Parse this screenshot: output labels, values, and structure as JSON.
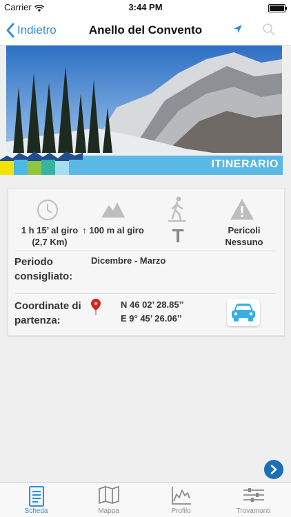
{
  "status_bar": {
    "carrier": "Carrier",
    "time": "3:44 PM"
  },
  "nav": {
    "back_label": "Indietro",
    "title": "Anello del Convento"
  },
  "banner": {
    "label": "ITINERARIO"
  },
  "stats": {
    "duration": "1 h 15’ al giro (2,7 Km)",
    "elevation": "↑ 100 m al giro",
    "difficulty": "T",
    "danger": "Pericoli Nessuno"
  },
  "period": {
    "label": "Periodo consigliato:",
    "value": "Dicembre - Marzo"
  },
  "coordinates": {
    "label": "Coordinate di partenza:",
    "lat": "N 46 02’ 28.85’’",
    "lon": "E 9° 45’ 26.06’’"
  },
  "tabs": [
    {
      "label": "Scheda",
      "icon": "document-icon",
      "active": true
    },
    {
      "label": "Mappa",
      "icon": "map-icon",
      "active": false
    },
    {
      "label": "Profilo",
      "icon": "profile-chart-icon",
      "active": false
    },
    {
      "label": "Trovamonti",
      "icon": "sliders-icon",
      "active": false
    }
  ],
  "colors": {
    "accent": "#2f8fd8",
    "banner": "#5ab8e6",
    "next_button": "#1a6fb6",
    "pin": "#d9201f"
  }
}
